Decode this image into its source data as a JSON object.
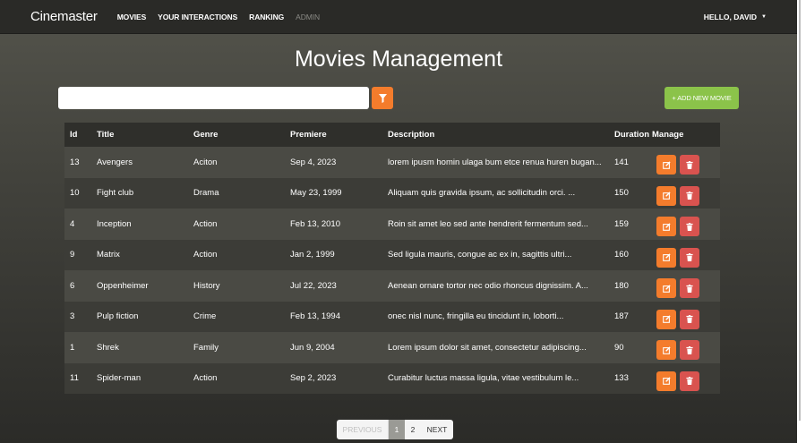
{
  "navbar": {
    "brand": "Cinemaster",
    "links": [
      "MOVIES",
      "YOUR INTERACTIONS",
      "RANKING",
      "ADMIN"
    ],
    "user": "HELLO, DAVID"
  },
  "page": {
    "title": "Movies Management",
    "search_value": "",
    "add_label": "+ ADD NEW MOVIE"
  },
  "table": {
    "headers": [
      "Id",
      "Title",
      "Genre",
      "Premiere",
      "Description",
      "Duration",
      "Manage"
    ],
    "rows": [
      {
        "id": "13",
        "title": "Avengers",
        "genre": "Aciton",
        "premiere": "Sep 4, 2023",
        "description": "lorem ipusm homin ulaga bum etce renua huren bugan...",
        "duration": "141"
      },
      {
        "id": "10",
        "title": "Fight club",
        "genre": "Drama",
        "premiere": "May 23, 1999",
        "description": "Aliquam quis gravida ipsum, ac sollicitudin orci. ...",
        "duration": "150"
      },
      {
        "id": "4",
        "title": "Inception",
        "genre": "Action",
        "premiere": "Feb 13, 2010",
        "description": "Roin sit amet leo sed ante hendrerit fermentum sed...",
        "duration": "159"
      },
      {
        "id": "9",
        "title": "Matrix",
        "genre": "Action",
        "premiere": "Jan 2, 1999",
        "description": "Sed ligula mauris, congue ac ex in, sagittis ultri...",
        "duration": "160"
      },
      {
        "id": "6",
        "title": "Oppenheimer",
        "genre": "History",
        "premiere": "Jul 22, 2023",
        "description": "Aenean ornare tortor nec odio rhoncus dignissim. A...",
        "duration": "180"
      },
      {
        "id": "3",
        "title": "Pulp fiction",
        "genre": "Crime",
        "premiere": "Feb 13, 1994",
        "description": "onec nisl nunc, fringilla eu tincidunt in, loborti...",
        "duration": "187"
      },
      {
        "id": "1",
        "title": "Shrek",
        "genre": "Family",
        "premiere": "Jun 9, 2004",
        "description": "Lorem ipsum dolor sit amet, consectetur adipiscing...",
        "duration": "90"
      },
      {
        "id": "11",
        "title": "Spider-man",
        "genre": "Action",
        "premiere": "Sep 2, 2023",
        "description": "Curabitur luctus massa ligula, vitae vestibulum le...",
        "duration": "133"
      }
    ]
  },
  "pagination": {
    "prev": "PREVIOUS",
    "pages": [
      "1",
      "2"
    ],
    "next": "NEXT"
  },
  "icons": {
    "filter": "filter-icon",
    "edit": "edit-icon",
    "delete": "trash-icon",
    "user_menu": "caret-down-icon"
  },
  "colors": {
    "accent_orange": "#f47c2c",
    "add_green": "#8bc34a",
    "delete_red": "#d9534f"
  }
}
